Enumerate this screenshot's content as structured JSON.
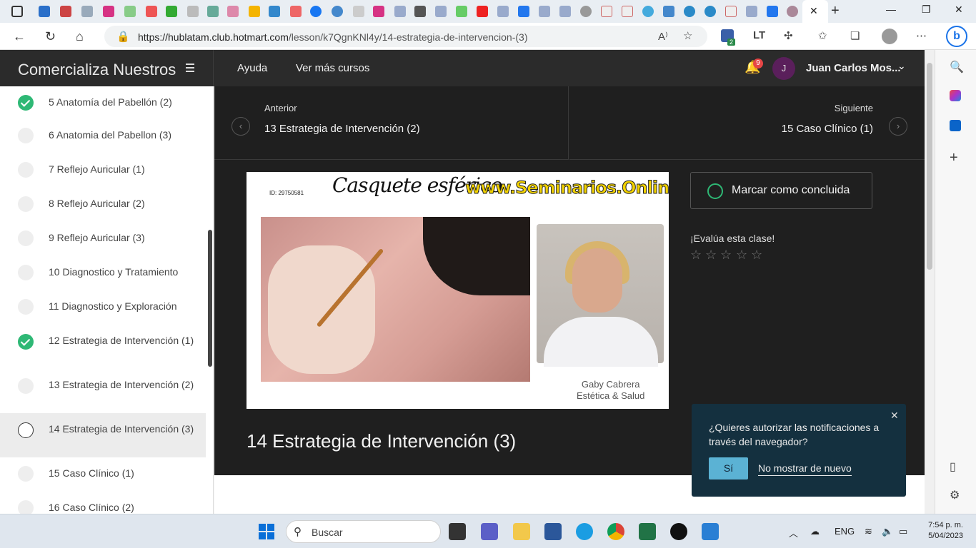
{
  "browser": {
    "url_host": "https://hublatam.club.hotmart.com",
    "url_path": "/lesson/k7QgnKNl4y/14-estrategia-de-intervencion-(3)",
    "read_aloud_icon": "A⁾",
    "extension_badge": "2",
    "tab_close": "✕",
    "new_tab": "+",
    "win_min": "—",
    "win_max": "❐",
    "win_close": "✕"
  },
  "header": {
    "brand": "Comercializa Nuestros",
    "links": [
      "Ayuda",
      "Ver más cursos"
    ],
    "notification_count": "9",
    "avatar_initial": "J",
    "user_name": "Juan Carlos Mos..."
  },
  "sidebar": {
    "lessons": [
      {
        "label": "5 Anatomía del Pabellón (2)",
        "status": "done"
      },
      {
        "label": "6 Anatomia del Pabellon (3)",
        "status": "todo"
      },
      {
        "label": "7 Reflejo Auricular (1)",
        "status": "todo"
      },
      {
        "label": "8 Reflejo Auricular (2)",
        "status": "todo"
      },
      {
        "label": "9 Reflejo Auricular (3)",
        "status": "todo"
      },
      {
        "label": "10 Diagnostico y Tratamiento",
        "status": "todo"
      },
      {
        "label": "11 Diagnostico y Exploración",
        "status": "todo"
      },
      {
        "label": "12 Estrategia de Intervención (1)",
        "status": "done"
      },
      {
        "label": "13 Estrategia de Intervención (2)",
        "status": "todo"
      },
      {
        "label": "14 Estrategia de Intervención (3)",
        "status": "current"
      },
      {
        "label": "15 Caso Clínico (1)",
        "status": "todo"
      },
      {
        "label": "16 Caso Clínico (2)",
        "status": "todo"
      }
    ]
  },
  "nav": {
    "prev_small": "Anterior",
    "prev_title": "13 Estrategia de Intervención (2)",
    "next_small": "Siguiente",
    "next_title": "15 Caso Clínico (1)"
  },
  "video": {
    "id_text": "ID: 29750581",
    "heading": "Casquete esférico",
    "site": "www.Seminarios.Online®",
    "credit_name": "Gaby Cabrera",
    "credit_sub": "Estética & Salud"
  },
  "lesson": {
    "title": "14 Estrategia de Intervención (3)",
    "complete_label": "Marcar como concluida",
    "rate_label": "¡Evalúa esta clase!",
    "rating": 0,
    "rating_max": 5
  },
  "notification_popup": {
    "text": "¿Quieres autorizar las notificaciones a través del navegador?",
    "yes": "Sí",
    "no": "No mostrar de nuevo"
  },
  "taskbar": {
    "search_placeholder": "Buscar",
    "lang": "ENG",
    "time": "7:54 p. m.",
    "date": "5/04/2023"
  },
  "colors": {
    "accent_green": "#2eb875",
    "header_bg": "#2b2b2b",
    "content_bg": "#1f1f1f",
    "popup_bg": "#14303f",
    "popup_button": "#5bb2d4",
    "badge_red": "#e64646"
  }
}
